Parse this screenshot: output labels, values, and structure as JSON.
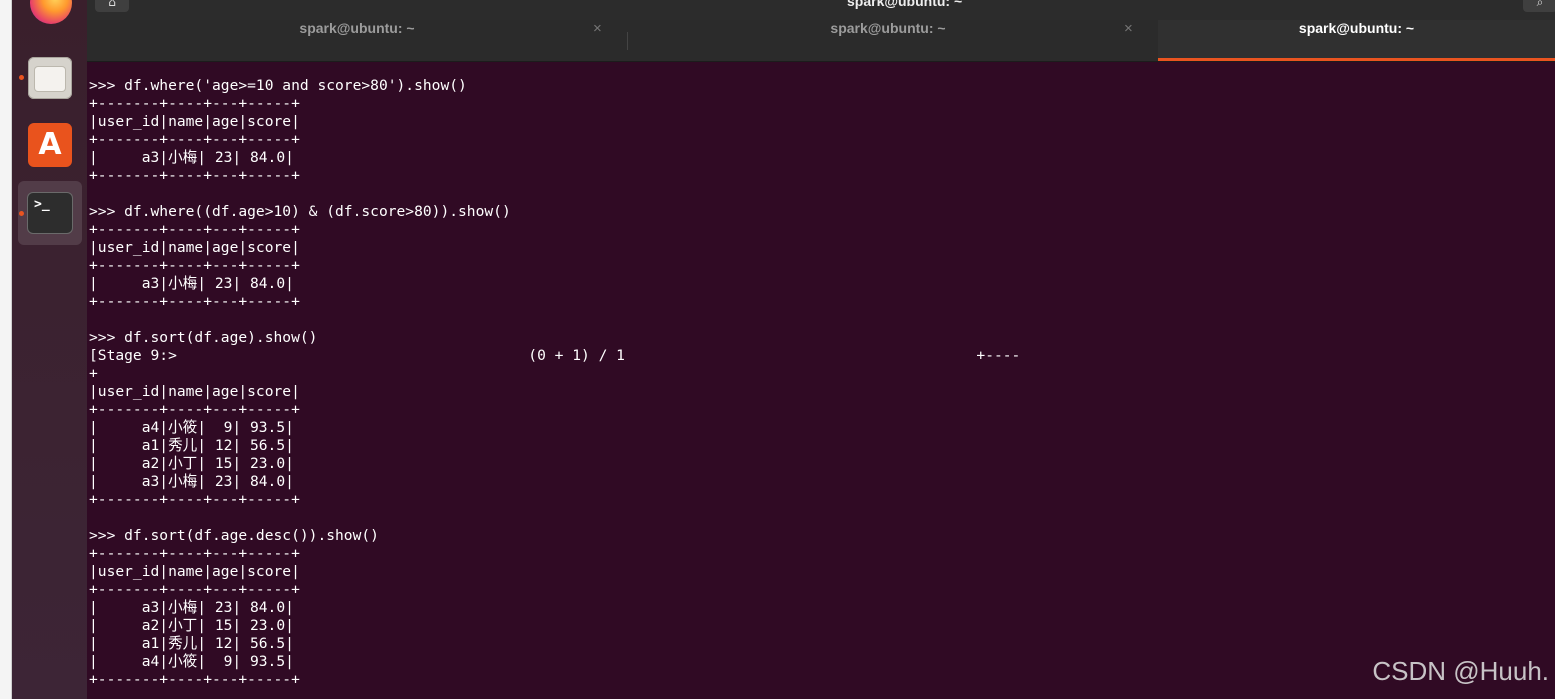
{
  "window": {
    "title": "spark@ubuntu: ~"
  },
  "tabs": [
    {
      "label": "spark@ubuntu: ~",
      "active": false
    },
    {
      "label": "spark@ubuntu: ~",
      "active": false
    },
    {
      "label": "spark@ubuntu: ~",
      "active": true
    }
  ],
  "dock": {
    "items": [
      "firefox-icon",
      "files-icon",
      "software-icon",
      "terminal-icon"
    ],
    "software_glyph": "A",
    "terminal_glyph": ">_"
  },
  "terminal": {
    "lines": [
      ">>> df.where('age>=10 and score>80').show()",
      "+-------+----+---+-----+",
      "|user_id|name|age|score|",
      "+-------+----+---+-----+",
      "|     a3|小梅| 23| 84.0|",
      "+-------+----+---+-----+",
      "",
      ">>> df.where((df.age>10) & (df.score>80)).show()",
      "+-------+----+---+-----+",
      "|user_id|name|age|score|",
      "+-------+----+---+-----+",
      "|     a3|小梅| 23| 84.0|",
      "+-------+----+---+-----+",
      "",
      ">>> df.sort(df.age).show()",
      "[Stage 9:>                                        (0 + 1) / 1                                        +----",
      "+",
      "|user_id|name|age|score|",
      "+-------+----+---+-----+",
      "|     a4|小筱|  9| 93.5|",
      "|     a1|秀儿| 12| 56.5|",
      "|     a2|小丁| 15| 23.0|",
      "|     a3|小梅| 23| 84.0|",
      "+-------+----+---+-----+",
      "",
      ">>> df.sort(df.age.desc()).show()",
      "+-------+----+---+-----+",
      "|user_id|name|age|score|",
      "+-------+----+---+-----+",
      "|     a3|小梅| 23| 84.0|",
      "|     a2|小丁| 15| 23.0|",
      "|     a1|秀儿| 12| 56.5|",
      "|     a4|小筱|  9| 93.5|",
      "+-------+----+---+-----+"
    ]
  },
  "watermark": "CSDN @Huuh.",
  "colors": {
    "terminal_bg": "#300a24",
    "accent": "#e95420"
  }
}
